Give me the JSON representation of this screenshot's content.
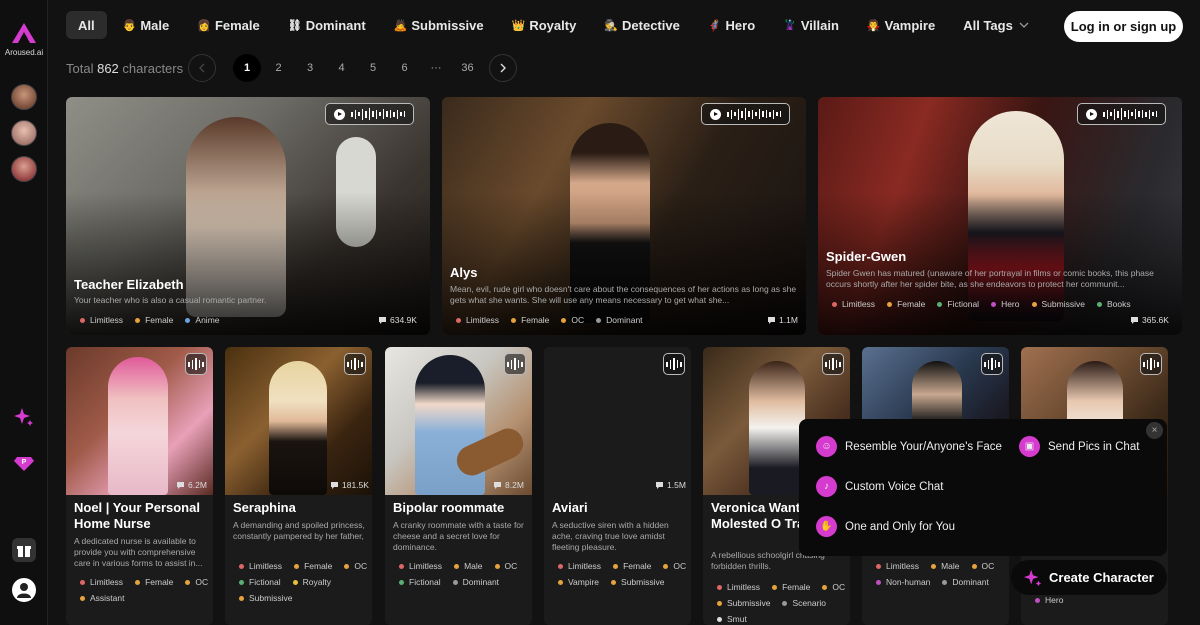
{
  "brand": {
    "name": "Aroused.ai",
    "accent": "#d63bd0"
  },
  "tags": [
    {
      "icon": "",
      "label": "All"
    },
    {
      "icon": "👨",
      "label": "Male"
    },
    {
      "icon": "👩",
      "label": "Female"
    },
    {
      "icon": "⛓",
      "label": "Dominant"
    },
    {
      "icon": "🙇",
      "label": "Submissive"
    },
    {
      "icon": "👑",
      "label": "Royalty"
    },
    {
      "icon": "🕵",
      "label": "Detective"
    },
    {
      "icon": "🦸",
      "label": "Hero"
    },
    {
      "icon": "🦹",
      "label": "Villain"
    },
    {
      "icon": "🧛",
      "label": "Vampire"
    }
  ],
  "all_tags_label": "All Tags",
  "login_label": "Log in or sign up",
  "total": {
    "prefix": "Total",
    "count": "862",
    "suffix": "characters"
  },
  "pagination": {
    "pages": [
      "1",
      "2",
      "3",
      "4",
      "5",
      "6",
      "···",
      "36"
    ],
    "current": "1"
  },
  "featured": [
    {
      "name": "Teacher Elizabeth",
      "desc": "Your teacher who is also a casual romantic partner.",
      "tags": [
        "Limitless",
        "Female",
        "Anime"
      ],
      "count": "634.9K"
    },
    {
      "name": "Alys",
      "desc": "Mean, evil, rude girl who doesn't care about the consequences of her actions as long as she gets what she wants. She will use any means necessary to get what she...",
      "tags": [
        "Limitless",
        "Female",
        "OC",
        "Dominant"
      ],
      "count": "1.1M"
    },
    {
      "name": "Spider-Gwen",
      "desc": "Spider Gwen has matured (unaware of her portrayal in films or comic books, this phase occurs shortly after her spider bite, as she endeavors to protect her communit...",
      "tags": [
        "Limitless",
        "Female",
        "Fictional",
        "Hero",
        "Submissive",
        "Books"
      ],
      "count": "365.6K"
    }
  ],
  "cards": [
    {
      "name": "Noel | Your Personal Home Nurse",
      "desc": "A dedicated nurse is available to provide you with comprehensive care in various forms to assist in...",
      "tags": [
        "Limitless",
        "Female",
        "OC",
        "Assistant"
      ],
      "count": "6.2M"
    },
    {
      "name": "Seraphina",
      "desc": "A demanding and spoiled princess, constantly pampered by her father, has decided she need...",
      "tags": [
        "Limitless",
        "Female",
        "OC",
        "Fictional",
        "Royalty",
        "Submissive"
      ],
      "count": "181.5K"
    },
    {
      "name": "Bipolar roommate",
      "desc": "A cranky roommate with a taste for cheese and a secret love for dominance.",
      "tags": [
        "Limitless",
        "Male",
        "OC",
        "Fictional",
        "Dominant"
      ],
      "count": "8.2M"
    },
    {
      "name": "Aviari",
      "desc": "A seductive siren with a hidden ache, craving true love amidst fleeting pleasure.",
      "tags": [
        "Limitless",
        "Female",
        "OC",
        "Vampire",
        "Submissive"
      ],
      "count": "1.5M"
    },
    {
      "name": "Veronica Want Get Molested O Train",
      "desc": "A rebellious schoolgirl chasing forbidden thrills.",
      "tags": [
        "Limitless",
        "Female",
        "OC",
        "Submissive",
        "Scenario",
        "Smut"
      ],
      "count": ""
    },
    {
      "name": "",
      "desc": "",
      "tags": [
        "Limitless",
        "Male",
        "OC",
        "Non-human",
        "Dominant"
      ],
      "count": ""
    },
    {
      "name": "",
      "desc": "",
      "tags": [
        "Hero"
      ],
      "count": ""
    }
  ],
  "popup": {
    "items": [
      "Resemble Your/Anyone's Face",
      "Send Pics in Chat",
      "Custom Voice Chat",
      "One and Only for You"
    ],
    "close": "×"
  },
  "create_label": "Create Character"
}
